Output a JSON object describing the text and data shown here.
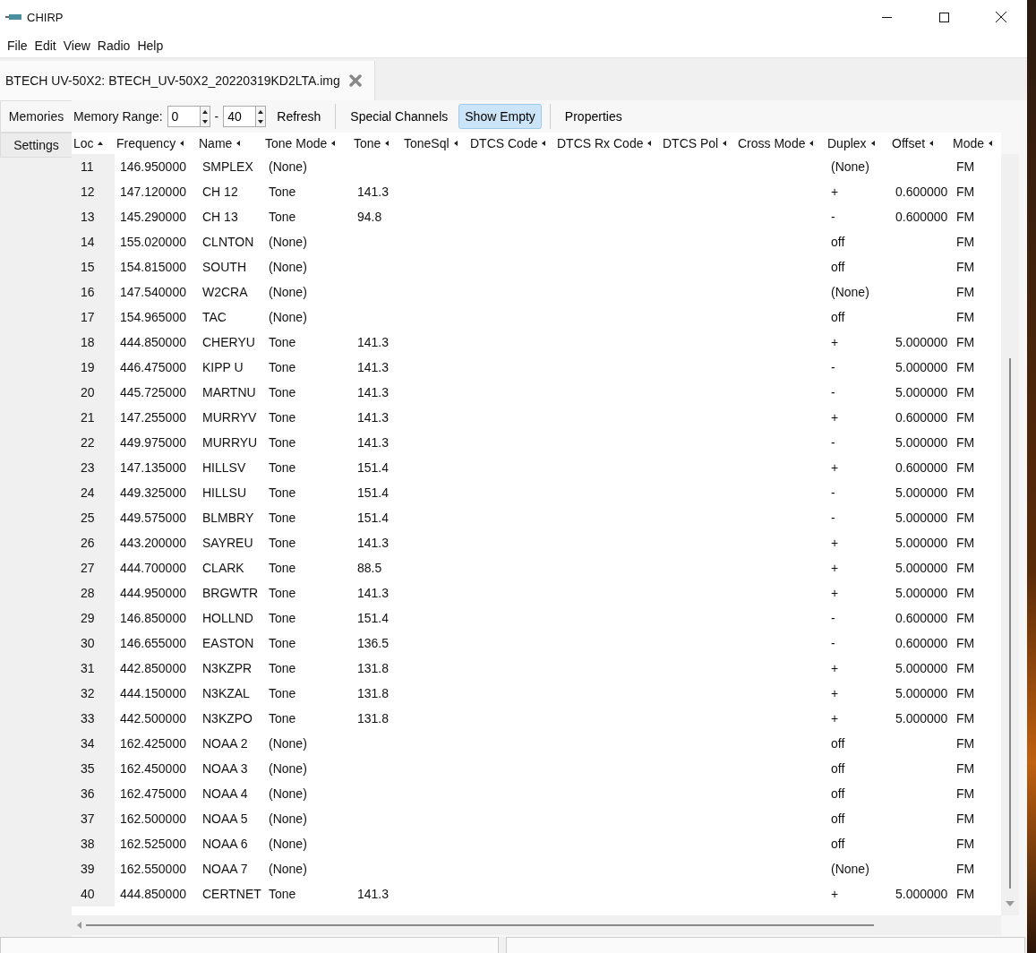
{
  "window": {
    "title": "CHIRP"
  },
  "menu": [
    "File",
    "Edit",
    "View",
    "Radio",
    "Help"
  ],
  "file_tab": {
    "label": "BTECH UV-50X2: BTECH_UV-50X2_20220319KD2LTA.img",
    "selected": true
  },
  "side_tabs": [
    {
      "label": "Memories",
      "selected": true
    },
    {
      "label": "Settings",
      "selected": false
    }
  ],
  "toolbar": {
    "range_label": "Memory Range:",
    "range_start": "0",
    "range_separator": "-",
    "range_end": "40",
    "refresh": "Refresh",
    "buttons": [
      {
        "label": "Special Channels",
        "pressed": false
      },
      {
        "label": "Show Empty",
        "pressed": true
      }
    ],
    "properties": "Properties"
  },
  "table": {
    "columns": [
      {
        "label": "Loc",
        "sorted": true
      },
      {
        "label": "Frequency",
        "sorted": false
      },
      {
        "label": "Name",
        "sorted": false
      },
      {
        "label": "Tone Mode",
        "sorted": false
      },
      {
        "label": "Tone",
        "sorted": false
      },
      {
        "label": "ToneSql",
        "sorted": false
      },
      {
        "label": "DTCS Code",
        "sorted": false
      },
      {
        "label": "DTCS Rx Code",
        "sorted": false
      },
      {
        "label": "DTCS Pol",
        "sorted": false
      },
      {
        "label": "Cross Mode",
        "sorted": false
      },
      {
        "label": "Duplex",
        "sorted": false
      },
      {
        "label": "Offset",
        "sorted": false
      },
      {
        "label": "Mode",
        "sorted": false
      }
    ],
    "rows": [
      [
        "11",
        "146.950000",
        "SMPLEX",
        "(None)",
        null,
        null,
        null,
        null,
        null,
        null,
        "(None)",
        null,
        "FM"
      ],
      [
        "12",
        "147.120000",
        "CH 12",
        "Tone",
        "141.3",
        null,
        null,
        null,
        null,
        null,
        "+",
        "0.600000",
        "FM"
      ],
      [
        "13",
        "145.290000",
        "CH 13",
        "Tone",
        "94.8",
        null,
        null,
        null,
        null,
        null,
        "-",
        "0.600000",
        "FM"
      ],
      [
        "14",
        "155.020000",
        "CLNTON",
        "(None)",
        null,
        null,
        null,
        null,
        null,
        null,
        "off",
        null,
        "FM"
      ],
      [
        "15",
        "154.815000",
        "SOUTH",
        "(None)",
        null,
        null,
        null,
        null,
        null,
        null,
        "off",
        null,
        "FM"
      ],
      [
        "16",
        "147.540000",
        "W2CRA",
        "(None)",
        null,
        null,
        null,
        null,
        null,
        null,
        "(None)",
        null,
        "FM"
      ],
      [
        "17",
        "154.965000",
        "TAC",
        "(None)",
        null,
        null,
        null,
        null,
        null,
        null,
        "off",
        null,
        "FM"
      ],
      [
        "18",
        "444.850000",
        "CHERYU",
        "Tone",
        "141.3",
        null,
        null,
        null,
        null,
        null,
        "+",
        "5.000000",
        "FM"
      ],
      [
        "19",
        "446.475000",
        "KIPP U",
        "Tone",
        "141.3",
        null,
        null,
        null,
        null,
        null,
        "-",
        "5.000000",
        "FM"
      ],
      [
        "20",
        "445.725000",
        "MARTNU",
        "Tone",
        "141.3",
        null,
        null,
        null,
        null,
        null,
        "-",
        "5.000000",
        "FM"
      ],
      [
        "21",
        "147.255000",
        "MURRYV",
        "Tone",
        "141.3",
        null,
        null,
        null,
        null,
        null,
        "+",
        "0.600000",
        "FM"
      ],
      [
        "22",
        "449.975000",
        "MURRYU",
        "Tone",
        "141.3",
        null,
        null,
        null,
        null,
        null,
        "-",
        "5.000000",
        "FM"
      ],
      [
        "23",
        "147.135000",
        "HILLSV",
        "Tone",
        "151.4",
        null,
        null,
        null,
        null,
        null,
        "+",
        "0.600000",
        "FM"
      ],
      [
        "24",
        "449.325000",
        "HILLSU",
        "Tone",
        "151.4",
        null,
        null,
        null,
        null,
        null,
        "-",
        "5.000000",
        "FM"
      ],
      [
        "25",
        "449.575000",
        "BLMBRY",
        "Tone",
        "151.4",
        null,
        null,
        null,
        null,
        null,
        "-",
        "5.000000",
        "FM"
      ],
      [
        "26",
        "443.200000",
        "SAYREU",
        "Tone",
        "141.3",
        null,
        null,
        null,
        null,
        null,
        "+",
        "5.000000",
        "FM"
      ],
      [
        "27",
        "444.700000",
        "CLARK",
        "Tone",
        "88.5",
        null,
        null,
        null,
        null,
        null,
        "+",
        "5.000000",
        "FM"
      ],
      [
        "28",
        "444.950000",
        "BRGWTR",
        "Tone",
        "141.3",
        null,
        null,
        null,
        null,
        null,
        "+",
        "5.000000",
        "FM"
      ],
      [
        "29",
        "146.850000",
        "HOLLND",
        "Tone",
        "151.4",
        null,
        null,
        null,
        null,
        null,
        "-",
        "0.600000",
        "FM"
      ],
      [
        "30",
        "146.655000",
        "EASTON",
        "Tone",
        "136.5",
        null,
        null,
        null,
        null,
        null,
        "-",
        "0.600000",
        "FM"
      ],
      [
        "31",
        "442.850000",
        "N3KZPR",
        "Tone",
        "131.8",
        null,
        null,
        null,
        null,
        null,
        "+",
        "5.000000",
        "FM"
      ],
      [
        "32",
        "444.150000",
        "N3KZAL",
        "Tone",
        "131.8",
        null,
        null,
        null,
        null,
        null,
        "+",
        "5.000000",
        "FM"
      ],
      [
        "33",
        "442.500000",
        "N3KZPO",
        "Tone",
        "131.8",
        null,
        null,
        null,
        null,
        null,
        "+",
        "5.000000",
        "FM"
      ],
      [
        "34",
        "162.425000",
        "NOAA 2",
        "(None)",
        null,
        null,
        null,
        null,
        null,
        null,
        "off",
        null,
        "FM"
      ],
      [
        "35",
        "162.450000",
        "NOAA 3",
        "(None)",
        null,
        null,
        null,
        null,
        null,
        null,
        "off",
        null,
        "FM"
      ],
      [
        "36",
        "162.475000",
        "NOAA 4",
        "(None)",
        null,
        null,
        null,
        null,
        null,
        null,
        "off",
        null,
        "FM"
      ],
      [
        "37",
        "162.500000",
        "NOAA 5",
        "(None)",
        null,
        null,
        null,
        null,
        null,
        null,
        "off",
        null,
        "FM"
      ],
      [
        "38",
        "162.525000",
        "NOAA 6",
        "(None)",
        null,
        null,
        null,
        null,
        null,
        null,
        "off",
        null,
        "FM"
      ],
      [
        "39",
        "162.550000",
        "NOAA 7",
        "(None)",
        null,
        null,
        null,
        null,
        null,
        null,
        "(None)",
        null,
        "FM"
      ],
      [
        "40",
        "444.850000",
        "CERTNET",
        "Tone",
        "141.3",
        null,
        null,
        null,
        null,
        null,
        "+",
        "5.000000",
        "FM"
      ]
    ]
  }
}
